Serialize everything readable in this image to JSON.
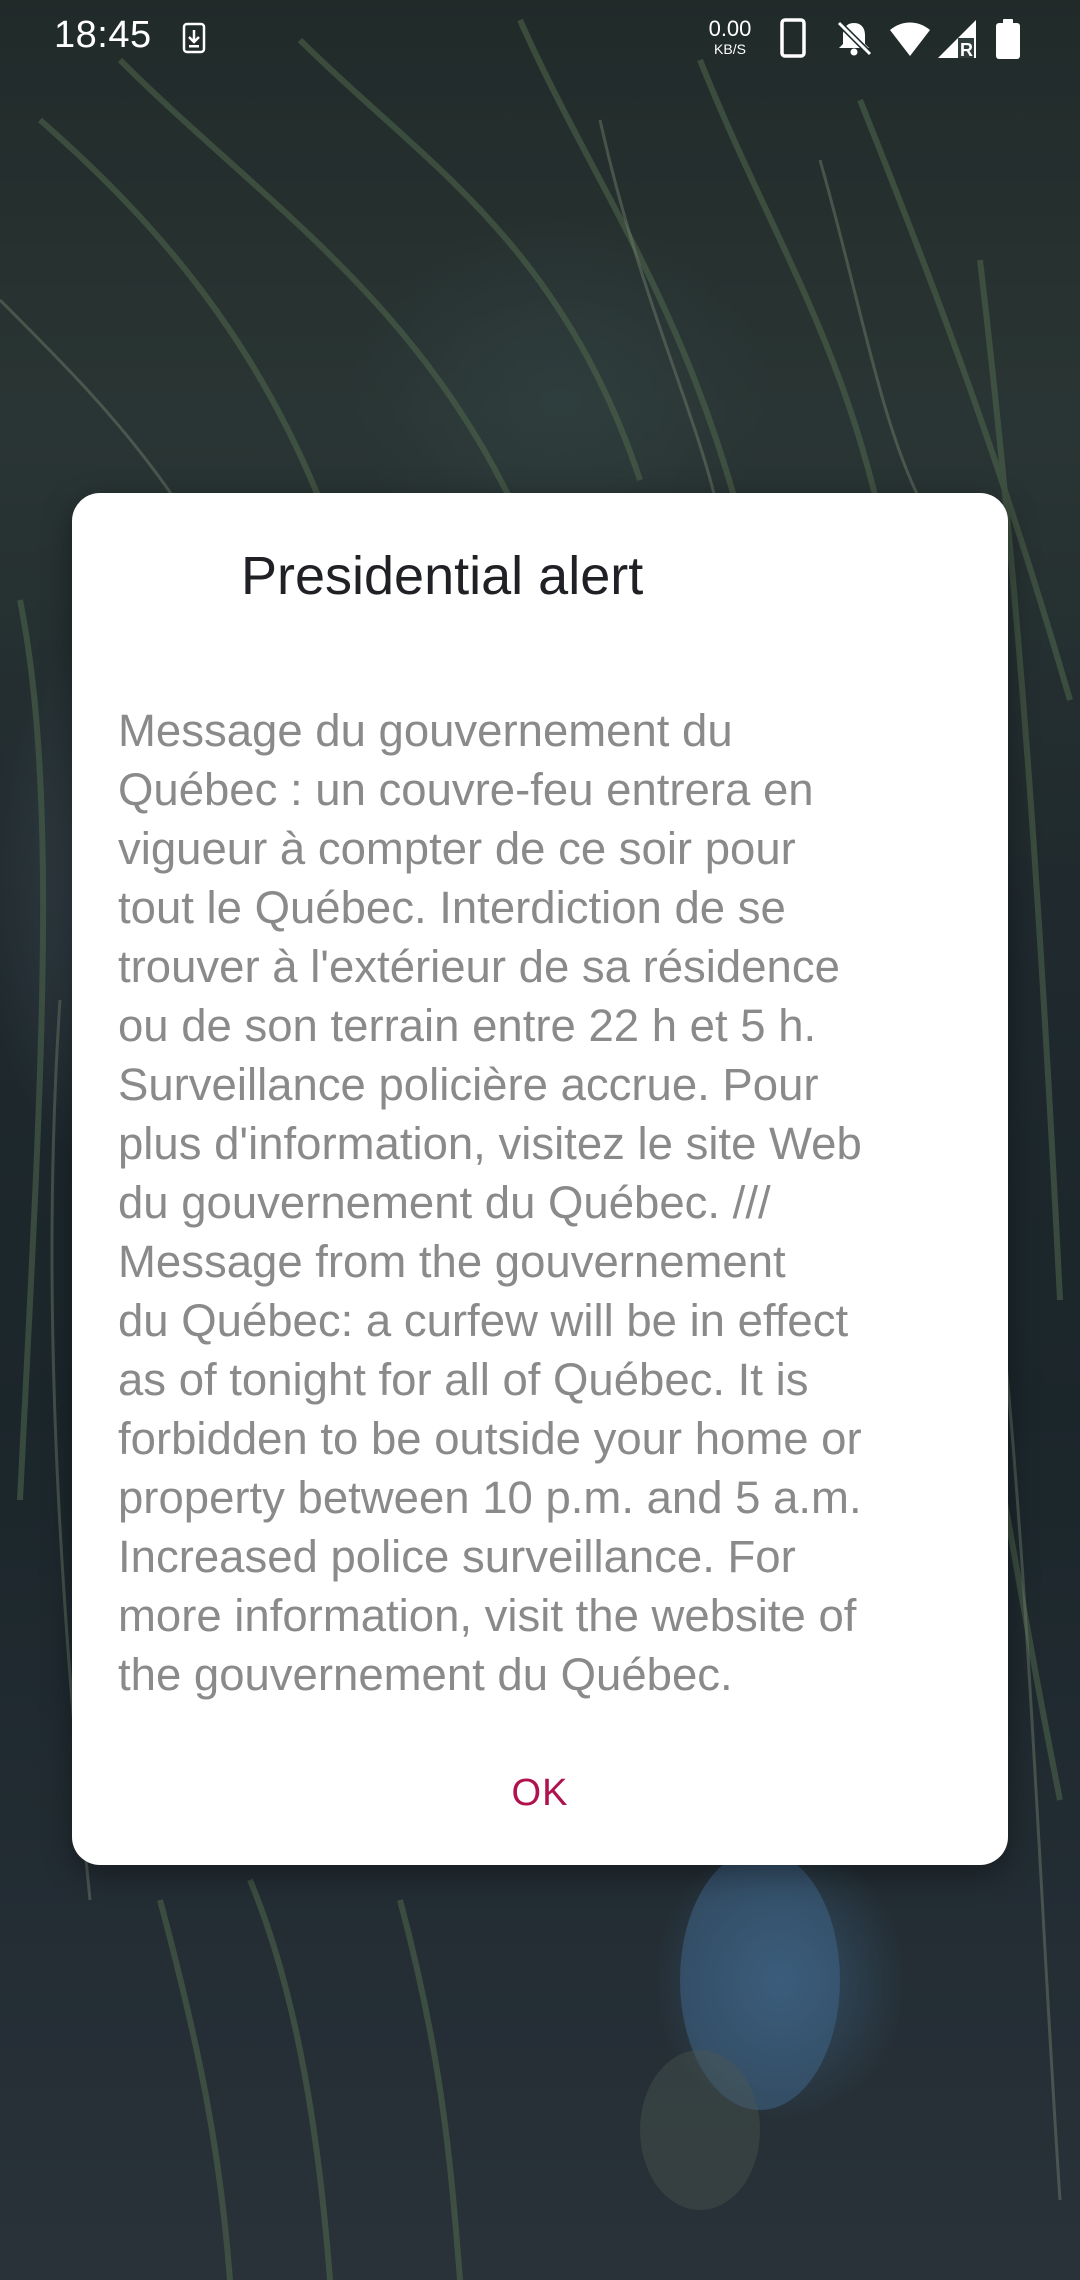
{
  "status_bar": {
    "time": "18:45",
    "net_speed_value": "0.00",
    "net_speed_unit": "KB/S",
    "icons": [
      "download-icon",
      "phone-icon",
      "notifications-off-icon",
      "wifi-icon",
      "cell-signal-roaming-icon",
      "battery-icon"
    ],
    "roaming_label": "R"
  },
  "dialog": {
    "title": "Presidential alert",
    "message": "Message du gouvernement du\nQuébec : un couvre-feu entrera en\nvigueur à compter de ce soir pour\ntout le Québec. Interdiction de se\ntrouver à l'extérieur de sa résidence\nou de son terrain entre 22 h et 5 h.\nSurveillance policière accrue. Pour\nplus d'information, visitez le site Web\ndu gouvernement du Québec. ///\nMessage from the gouvernement\ndu Québec: a curfew will be in effect\nas of tonight for all of Québec. It is\nforbidden to be outside your home or\nproperty between 10 p.m. and 5 a.m.\nIncreased police surveillance. For\nmore information, visit the website of\nthe gouvernement du Québec.",
    "ok_label": "OK"
  },
  "colors": {
    "accent": "#b0124e",
    "title": "#202124",
    "message": "#8a8a8a",
    "dialog_bg": "#ffffff"
  }
}
